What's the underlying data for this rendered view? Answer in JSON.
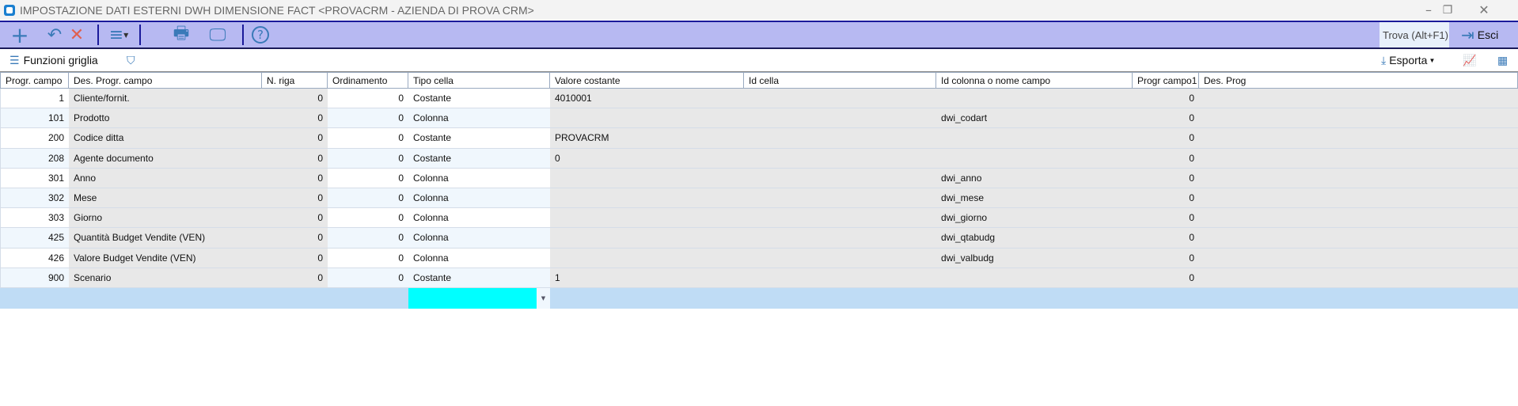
{
  "window": {
    "title": "IMPOSTAZIONE DATI ESTERNI DWH DIMENSIONE FACT <PROVACRM - AZIENDA DI PROVA CRM>"
  },
  "toolbar": {
    "find_label": "Trova (Alt+F1)",
    "exit_label": "Esci"
  },
  "subtoolbar": {
    "grid_functions": "Funzioni griglia",
    "export": "Esporta"
  },
  "columns": [
    "Progr. campo",
    "Des. Progr. campo",
    "N. riga",
    "Ordinamento",
    "Tipo cella",
    "Valore costante",
    "Id cella",
    "Id colonna o nome campo",
    "Progr campo1",
    "Des. Prog"
  ],
  "rows": [
    [
      "1",
      "Cliente/fornit.",
      "0",
      "0",
      "Costante",
      "4010001",
      "",
      "",
      "0",
      ""
    ],
    [
      "101",
      "Prodotto",
      "0",
      "0",
      "Colonna",
      "",
      "",
      "dwi_codart",
      "0",
      ""
    ],
    [
      "200",
      "Codice ditta",
      "0",
      "0",
      "Costante",
      "PROVACRM",
      "",
      "",
      "0",
      ""
    ],
    [
      "208",
      "Agente documento",
      "0",
      "0",
      "Costante",
      "0",
      "",
      "",
      "0",
      ""
    ],
    [
      "301",
      "Anno",
      "0",
      "0",
      "Colonna",
      "",
      "",
      "dwi_anno",
      "0",
      ""
    ],
    [
      "302",
      "Mese",
      "0",
      "0",
      "Colonna",
      "",
      "",
      "dwi_mese",
      "0",
      ""
    ],
    [
      "303",
      "Giorno",
      "0",
      "0",
      "Colonna",
      "",
      "",
      "dwi_giorno",
      "0",
      ""
    ],
    [
      "425",
      "Quantità Budget Vendite (VEN)",
      "0",
      "0",
      "Colonna",
      "",
      "",
      "dwi_qtabudg",
      "0",
      ""
    ],
    [
      "426",
      "Valore Budget Vendite (VEN)",
      "0",
      "0",
      "Colonna",
      "",
      "",
      "dwi_valbudg",
      "0",
      ""
    ],
    [
      "900",
      "Scenario",
      "0",
      "0",
      "Costante",
      "1",
      "",
      "",
      "0",
      ""
    ]
  ],
  "colors": {
    "toolbar": "#b7b9f2",
    "new_row": "#bfdcf5",
    "active_cell": "#00ffff"
  }
}
